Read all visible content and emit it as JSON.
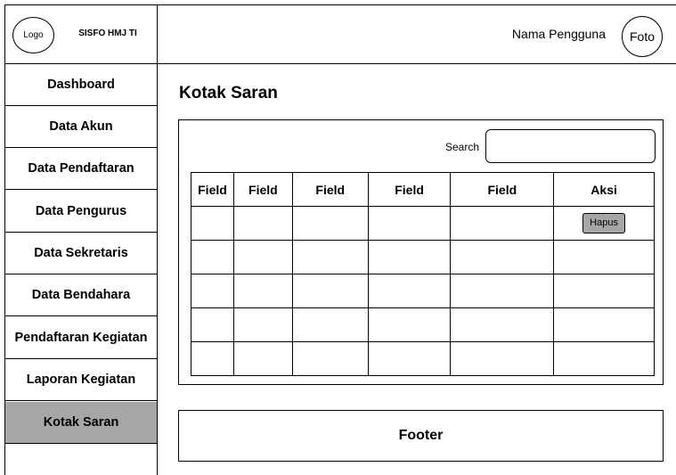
{
  "brand": {
    "logo": "Logo",
    "name": "SISFO HMJ TI"
  },
  "header": {
    "username": "Nama Pengguna",
    "photo": "Foto"
  },
  "sidebar": {
    "items": [
      {
        "label": "Dashboard"
      },
      {
        "label": "Data Akun"
      },
      {
        "label": "Data Pendaftaran"
      },
      {
        "label": "Data Pengurus"
      },
      {
        "label": "Data Sekretaris"
      },
      {
        "label": "Data Bendahara"
      },
      {
        "label": "Pendaftaran Kegiatan"
      },
      {
        "label": "Laporan Kegiatan"
      },
      {
        "label": "Kotak Saran",
        "active": true
      }
    ]
  },
  "main": {
    "title": "Kotak Saran",
    "search_label": "Search",
    "search_value": "",
    "table": {
      "columns": [
        "Field",
        "Field",
        "Field",
        "Field",
        "Field",
        "Aksi"
      ],
      "action_label": "Hapus"
    }
  },
  "footer": {
    "label": "Footer"
  },
  "colors": {
    "active_menu": "#a6a6a6",
    "button": "#a6a6a6"
  }
}
